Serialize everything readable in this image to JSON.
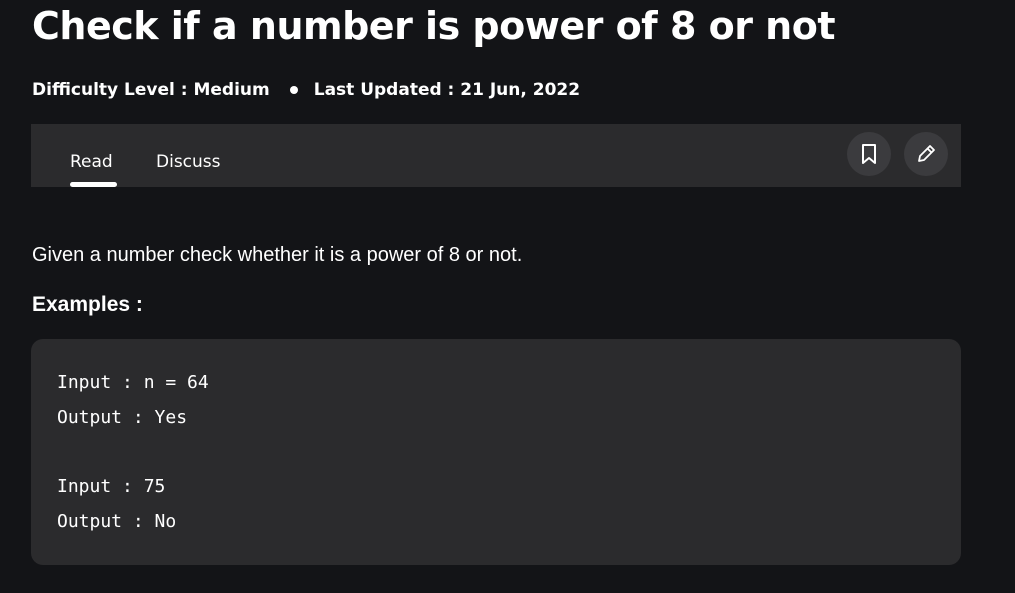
{
  "article": {
    "title": "Check if a number is power of 8 or not",
    "difficulty": "Difficulty Level : Medium",
    "last_updated": "Last Updated : 21 Jun, 2022"
  },
  "tabs": {
    "read": "Read",
    "discuss": "Discuss"
  },
  "actions": {
    "bookmark_icon": "bookmark-icon",
    "edit_icon": "pencil-icon"
  },
  "content": {
    "description": "Given a number check whether it is a power of 8 or not.",
    "examples_heading": "Examples :",
    "code_lines": [
      "Input : n = 64",
      "Output : Yes",
      "Input : 75",
      "Output : No"
    ]
  },
  "colors": {
    "background": "#131417",
    "panel": "#2b2b2d",
    "button": "#3b3b3e",
    "text": "#ffffff"
  }
}
